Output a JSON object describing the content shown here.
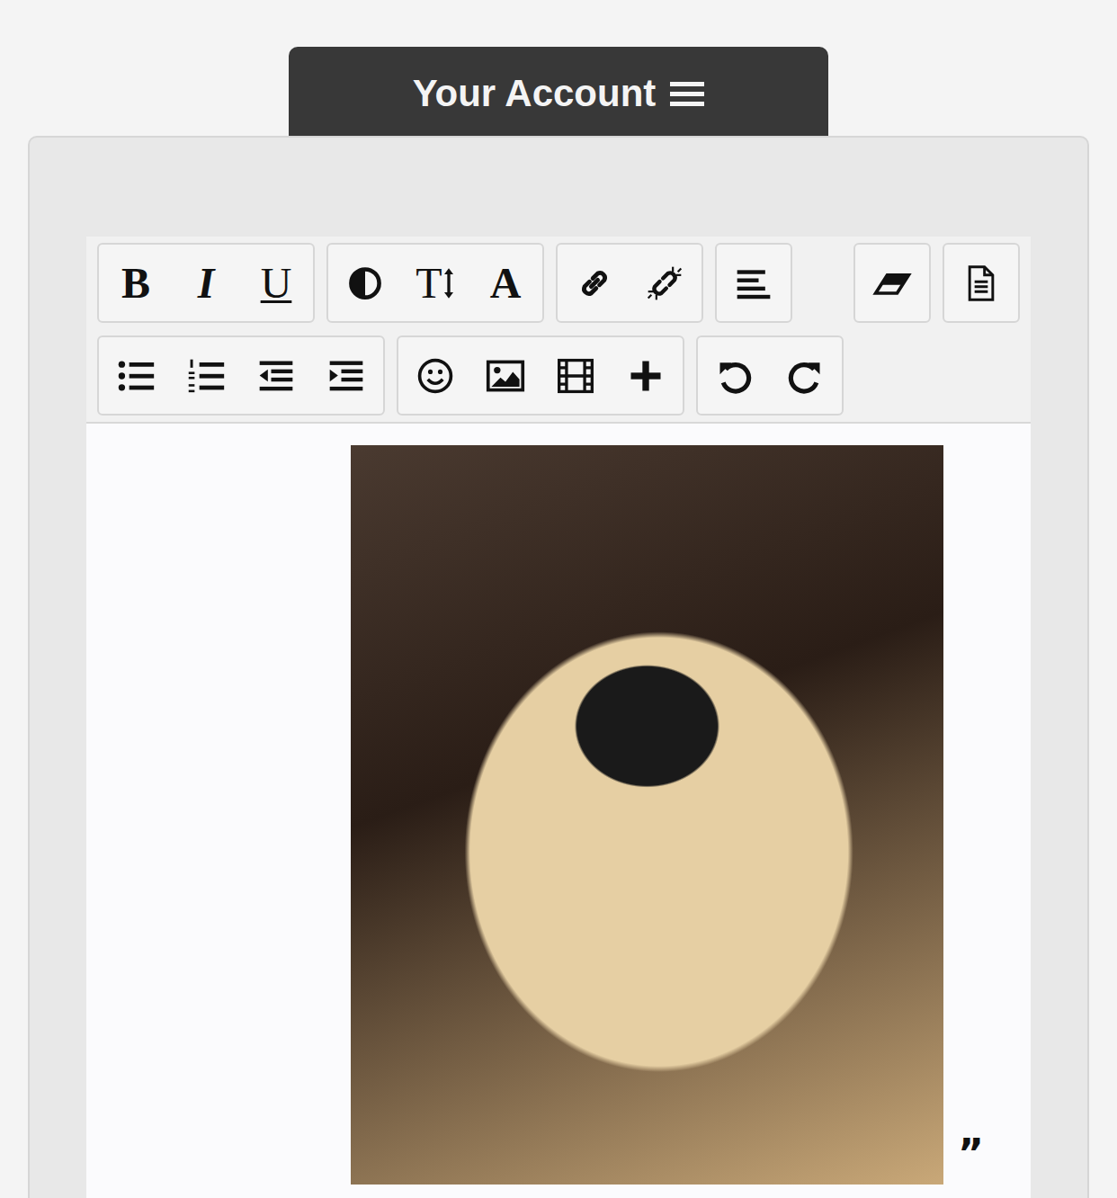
{
  "header": {
    "title": "Your Account"
  },
  "toolbar": {
    "bold": "B",
    "italic": "I",
    "underline": "U",
    "font_size": "T",
    "font_name": "A"
  },
  "content": {
    "quote_mark": "”"
  }
}
